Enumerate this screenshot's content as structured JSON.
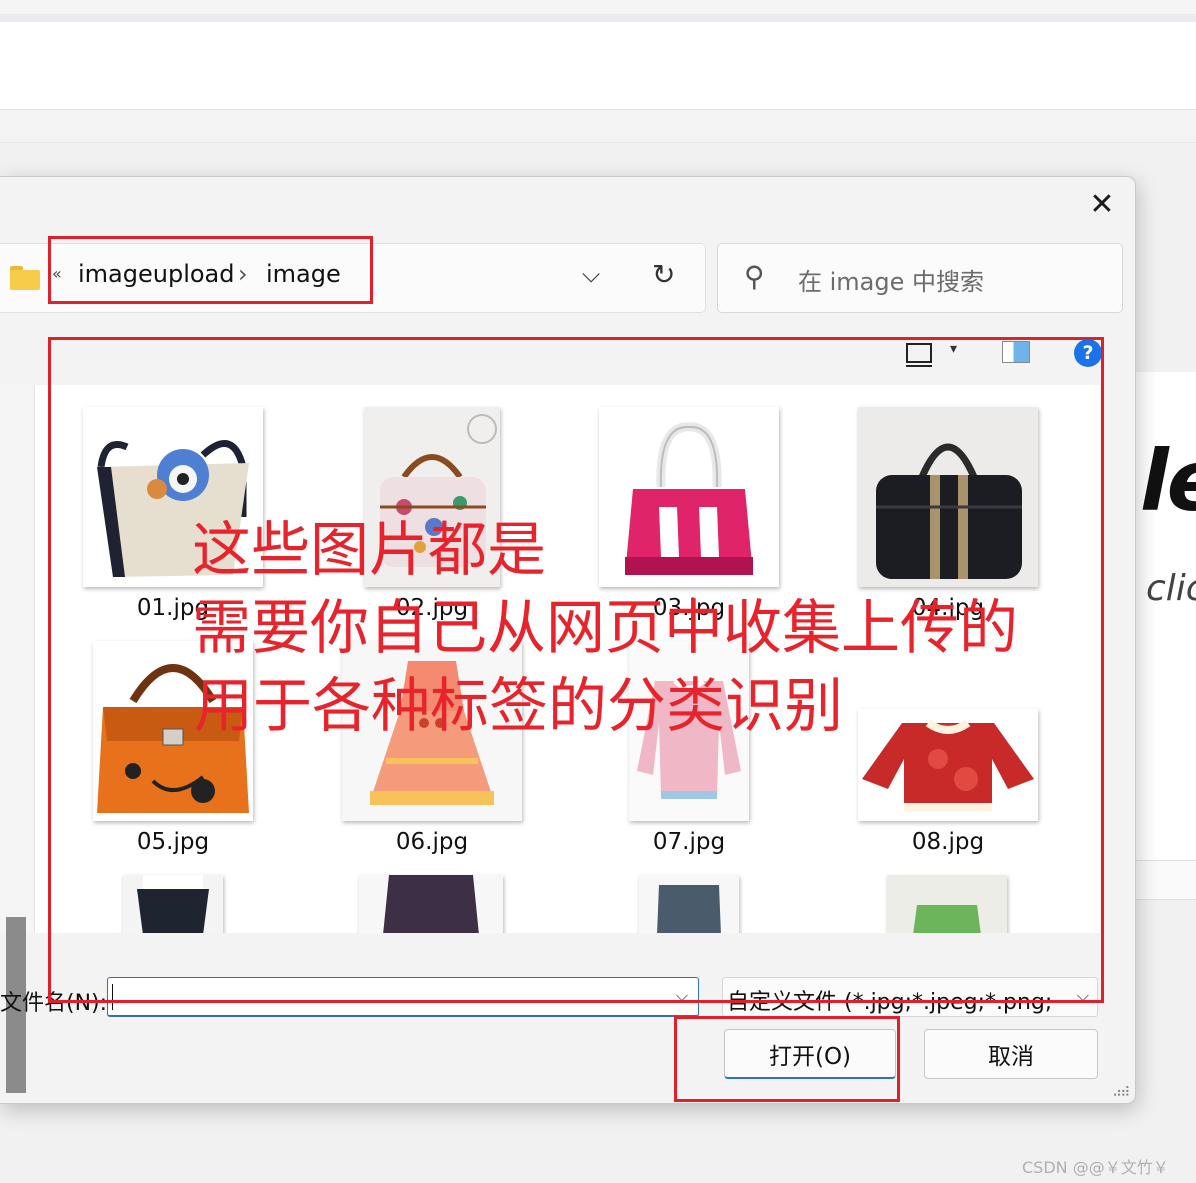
{
  "dialog": {
    "close_glyph": "✕",
    "address": {
      "chevrons": "«",
      "crumbs": [
        "imageupload",
        "image"
      ],
      "separator": "›",
      "dropdown_glyph": "⌵",
      "refresh_glyph": "↻"
    },
    "search": {
      "placeholder": "在 image 中搜索",
      "icon_glyph": "⚲"
    },
    "toolbar": {
      "view_drop_glyph": "▾",
      "help_glyph": "?"
    },
    "files": [
      {
        "name": "01.jpg"
      },
      {
        "name": "02.jpg"
      },
      {
        "name": "03.jpg"
      },
      {
        "name": "04.jpg"
      },
      {
        "name": "05.jpg"
      },
      {
        "name": "06.jpg"
      },
      {
        "name": "07.jpg"
      },
      {
        "name": "08.jpg"
      }
    ],
    "filename": {
      "label": "文件名(N):",
      "value": "",
      "drop_glyph": "⌵"
    },
    "filetype": {
      "value": "自定义文件 (*.jpg;*.jpeg;*.png;",
      "drop_glyph": "⌵"
    },
    "buttons": {
      "open": "打开(O)",
      "cancel": "取消"
    },
    "grip_glyph": "⣠⣴"
  },
  "annotations": {
    "line1": "这些图片都是",
    "line2": "需要你自己从网页中收集上传的",
    "line3": "用于各种标签的分类识别",
    "color": "#e8232b"
  },
  "background": {
    "title_fragment": "le",
    "subtitle_fragment": "clic"
  },
  "watermark": "CSDN @@￥文竹￥",
  "colors": {
    "accent": "#2f6fc2",
    "help": "#1a73e8",
    "annotation": "#e0202a"
  }
}
